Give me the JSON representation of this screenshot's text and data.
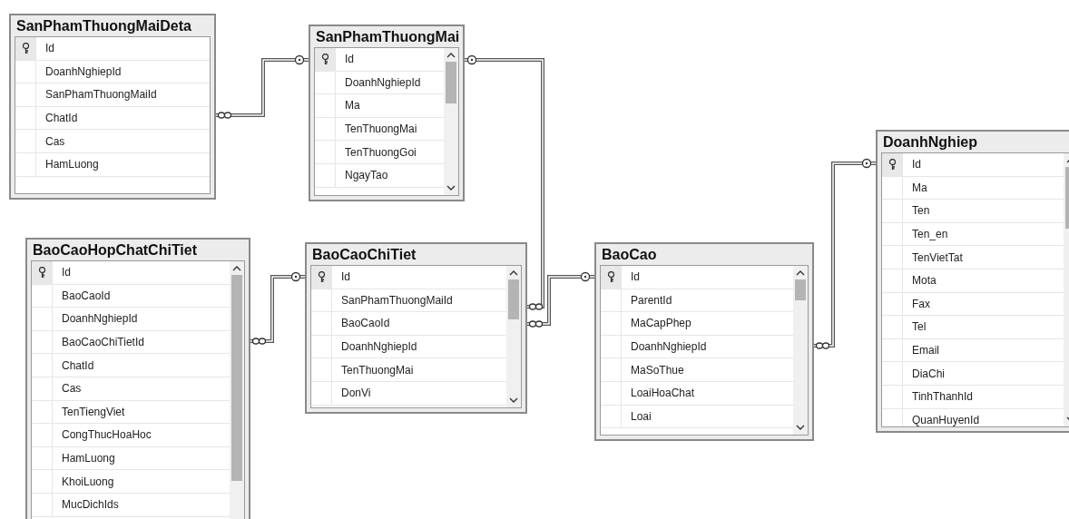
{
  "tables": [
    {
      "title": "SanPhamThuongMaiDeta",
      "scrollable": false,
      "columns": [
        {
          "name": "Id",
          "key": true
        },
        {
          "name": "DoanhNghiepId",
          "key": false
        },
        {
          "name": "SanPhamThuongMaiId",
          "key": false
        },
        {
          "name": "ChatId",
          "key": false
        },
        {
          "name": "Cas",
          "key": false
        },
        {
          "name": "HamLuong",
          "key": false
        }
      ]
    },
    {
      "title": "SanPhamThuongMai",
      "scrollable": true,
      "columns": [
        {
          "name": "Id",
          "key": true
        },
        {
          "name": "DoanhNghiepId",
          "key": false
        },
        {
          "name": "Ma",
          "key": false
        },
        {
          "name": "TenThuongMai",
          "key": false
        },
        {
          "name": "TenThuongGoi",
          "key": false
        },
        {
          "name": "NgayTao",
          "key": false
        }
      ]
    },
    {
      "title": "BaoCaoHopChatChiTiet",
      "scrollable": true,
      "columns": [
        {
          "name": "Id",
          "key": true
        },
        {
          "name": "BaoCaoId",
          "key": false
        },
        {
          "name": "DoanhNghiepId",
          "key": false
        },
        {
          "name": "BaoCaoChiTietId",
          "key": false
        },
        {
          "name": "ChatId",
          "key": false
        },
        {
          "name": "Cas",
          "key": false
        },
        {
          "name": "TenTiengViet",
          "key": false
        },
        {
          "name": "CongThucHoaHoc",
          "key": false
        },
        {
          "name": "HamLuong",
          "key": false
        },
        {
          "name": "KhoiLuong",
          "key": false
        },
        {
          "name": "MucDichIds",
          "key": false
        }
      ]
    },
    {
      "title": "BaoCaoChiTiet",
      "scrollable": true,
      "columns": [
        {
          "name": "Id",
          "key": true
        },
        {
          "name": "SanPhamThuongMaiId",
          "key": false
        },
        {
          "name": "BaoCaoId",
          "key": false
        },
        {
          "name": "DoanhNghiepId",
          "key": false
        },
        {
          "name": "TenThuongMai",
          "key": false
        },
        {
          "name": "DonVi",
          "key": false
        }
      ]
    },
    {
      "title": "BaoCao",
      "scrollable": true,
      "columns": [
        {
          "name": "Id",
          "key": true
        },
        {
          "name": "ParentId",
          "key": false
        },
        {
          "name": "MaCapPhep",
          "key": false
        },
        {
          "name": "DoanhNghiepId",
          "key": false
        },
        {
          "name": "MaSoThue",
          "key": false
        },
        {
          "name": "LoaiHoaChat",
          "key": false
        },
        {
          "name": "Loai",
          "key": false
        }
      ]
    },
    {
      "title": "DoanhNghiep",
      "scrollable": true,
      "columns": [
        {
          "name": "Id",
          "key": true
        },
        {
          "name": "Ma",
          "key": false
        },
        {
          "name": "Ten",
          "key": false
        },
        {
          "name": "Ten_en",
          "key": false
        },
        {
          "name": "TenVietTat",
          "key": false
        },
        {
          "name": "Mota",
          "key": false
        },
        {
          "name": "Fax",
          "key": false
        },
        {
          "name": "Tel",
          "key": false
        },
        {
          "name": "Email",
          "key": false
        },
        {
          "name": "DiaChi",
          "key": false
        },
        {
          "name": "TinhThanhId",
          "key": false
        },
        {
          "name": "QuanHuyenId",
          "key": false
        }
      ]
    }
  ]
}
